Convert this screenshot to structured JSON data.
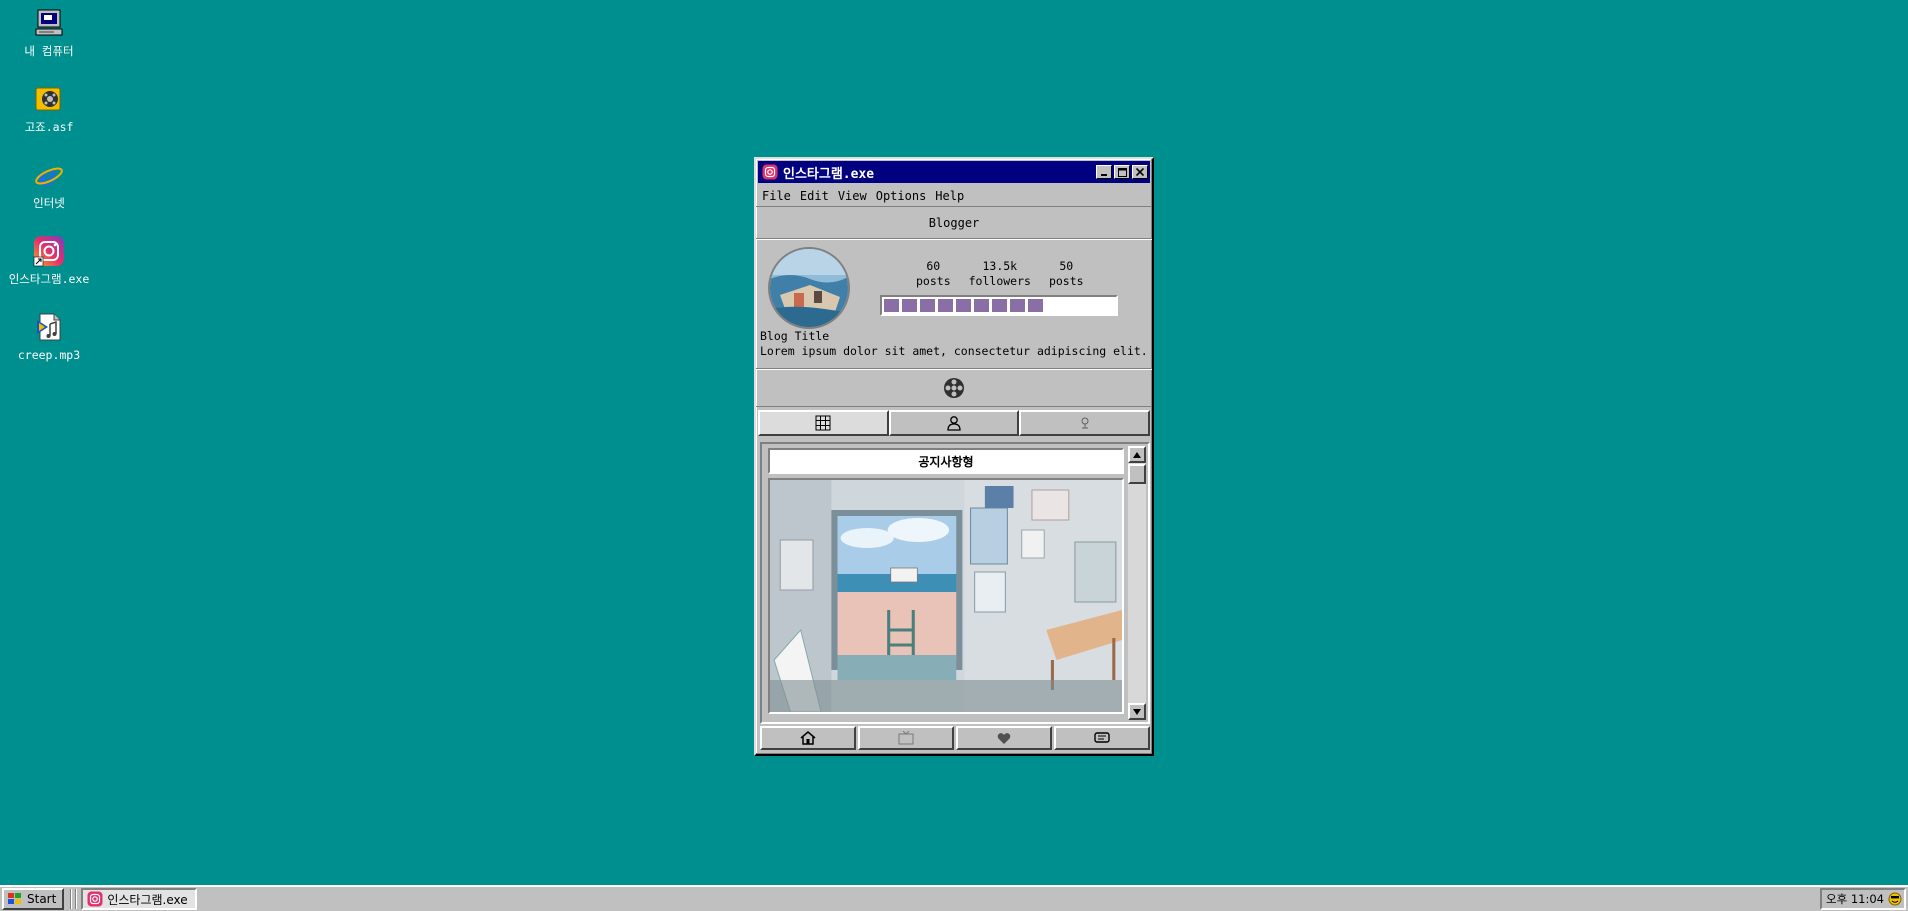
{
  "desktop": {
    "icons": [
      {
        "label": "내 컴퓨터",
        "icon": "computer-icon"
      },
      {
        "label": "고죠.asf",
        "icon": "media-file-icon"
      },
      {
        "label": "인터넷",
        "icon": "internet-explorer-icon"
      },
      {
        "label": "인스타그램.exe",
        "icon": "instagram-icon"
      },
      {
        "label": "creep.mp3",
        "icon": "audio-file-icon"
      }
    ]
  },
  "window": {
    "title": "인스타그램.exe",
    "menu": [
      "File",
      "Edit",
      "View",
      "Options",
      "Help"
    ],
    "username": "Blogger",
    "stats": [
      {
        "value": "60",
        "label": "posts"
      },
      {
        "value": "13.5k",
        "label": "followers"
      },
      {
        "value": "50",
        "label": "posts"
      }
    ],
    "progress": 0.68,
    "bio_title": "Blog Title",
    "bio_text": "Lorem ipsum dolor sit amet, consectetur adipiscing elit.",
    "tabs": [
      "grid-icon",
      "person-icon",
      "tagged-icon"
    ],
    "feed": {
      "notice": "공지사항형"
    },
    "bottom_nav": [
      "home-icon",
      "tv-icon",
      "heart-icon",
      "message-icon"
    ]
  },
  "taskbar": {
    "start_label": "Start",
    "task_label": "인스타그램.exe",
    "clock": "오후 11:04"
  },
  "colors": {
    "desktop": "#008f8f",
    "titlebar": "#000080",
    "chrome": "#c0c0c0",
    "progress": "#8a6fa6"
  }
}
